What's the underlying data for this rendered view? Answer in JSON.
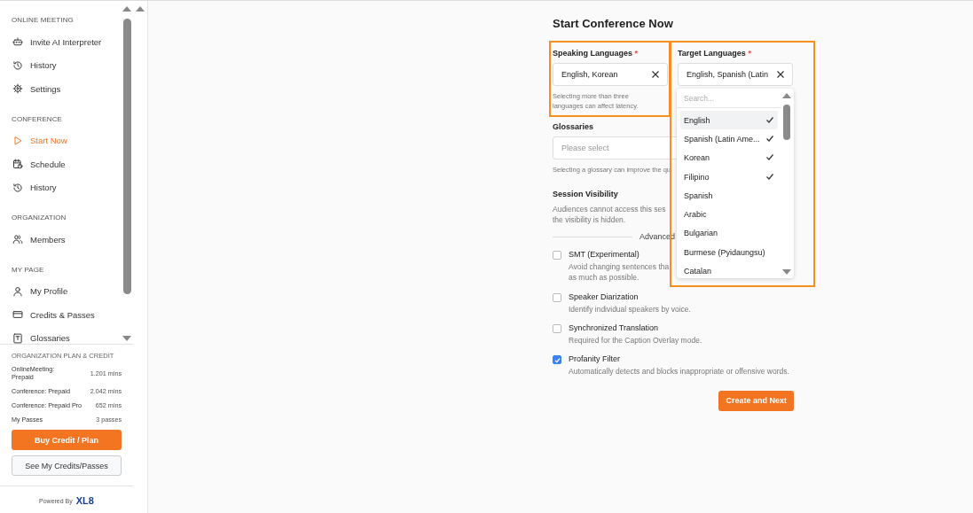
{
  "sidebar": {
    "sections": [
      {
        "title": "ONLINE MEETING",
        "items": [
          {
            "label": "Invite AI Interpreter",
            "selected": false
          },
          {
            "label": "History",
            "selected": false
          },
          {
            "label": "Settings",
            "selected": false
          }
        ]
      },
      {
        "title": "CONFERENCE",
        "items": [
          {
            "label": "Start Now",
            "selected": true
          },
          {
            "label": "Schedule",
            "selected": false
          },
          {
            "label": "History",
            "selected": false
          }
        ]
      },
      {
        "title": "ORGANIZATION",
        "items": [
          {
            "label": "Members",
            "selected": false
          }
        ]
      },
      {
        "title": "MY PAGE",
        "items": [
          {
            "label": "My Profile",
            "selected": false
          },
          {
            "label": "Credits & Passes",
            "selected": false
          },
          {
            "label": "Glossaries",
            "selected": false
          }
        ]
      }
    ],
    "plan": {
      "title": "ORGANIZATION PLAN & CREDIT",
      "rows": [
        {
          "label": "OnlineMeeting: Prepaid",
          "value": "1.201 mins"
        },
        {
          "label": "Conference: Prepaid",
          "value": "2.042 mins"
        },
        {
          "label": "Conference: Prepaid Pro",
          "value": "652 mins"
        },
        {
          "label": "My Passes",
          "value": "3 passes"
        }
      ],
      "primary_button": "Buy Credit / Plan",
      "secondary_button": "See My Credits/Passes"
    },
    "footer": {
      "text": "Powered By",
      "logo": "XL8"
    }
  },
  "form": {
    "title": "Start Conference Now",
    "speaking": {
      "label": "Speaking Languages",
      "required": "*",
      "value": "English, Korean",
      "hint": "Selecting more than three languages can affect latency."
    },
    "target": {
      "label": "Target Languages",
      "required": "*",
      "value": "English, Spanish (Latin"
    },
    "glossaries": {
      "label": "Glossaries",
      "placeholder": "Please select",
      "hint": "Selecting a glossary can improve the qu"
    },
    "visibility": {
      "label": "Session Visibility",
      "text": "Audiences cannot access this ses",
      "text_2": "the visibility is hidden."
    },
    "advanced": "Advanced",
    "options": [
      {
        "label": "SMT (Experimental)",
        "description": "Avoid changing sentences tha",
        "description_2": "as much as possible.",
        "checked": false
      },
      {
        "label": "Speaker Diarization",
        "description": "Identify individual speakers by voice.",
        "checked": false
      },
      {
        "label": "Synchronized Translation",
        "description": "Required for the Caption Overlay mode.",
        "checked": false
      },
      {
        "label": "Profanity Filter",
        "description": "Automatically detects and blocks inappropriate or offensive words.",
        "checked": true
      }
    ],
    "submit": "Create and Next"
  },
  "dropdown": {
    "placeholder": "Search...",
    "items": [
      {
        "label": "English",
        "checked": true,
        "selected": true
      },
      {
        "label": "Spanish (Latin Ame...",
        "checked": true,
        "selected": false
      },
      {
        "label": "Korean",
        "checked": true,
        "selected": false
      },
      {
        "label": "Filipino",
        "checked": true,
        "selected": false
      },
      {
        "label": "Spanish",
        "checked": false,
        "selected": false
      },
      {
        "label": "Arabic",
        "checked": false,
        "selected": false
      },
      {
        "label": "Bulgarian",
        "checked": false,
        "selected": false
      },
      {
        "label": "Burmese (Pyidaungsu)",
        "checked": false,
        "selected": false
      },
      {
        "label": "Catalan",
        "checked": false,
        "selected": false
      }
    ]
  }
}
